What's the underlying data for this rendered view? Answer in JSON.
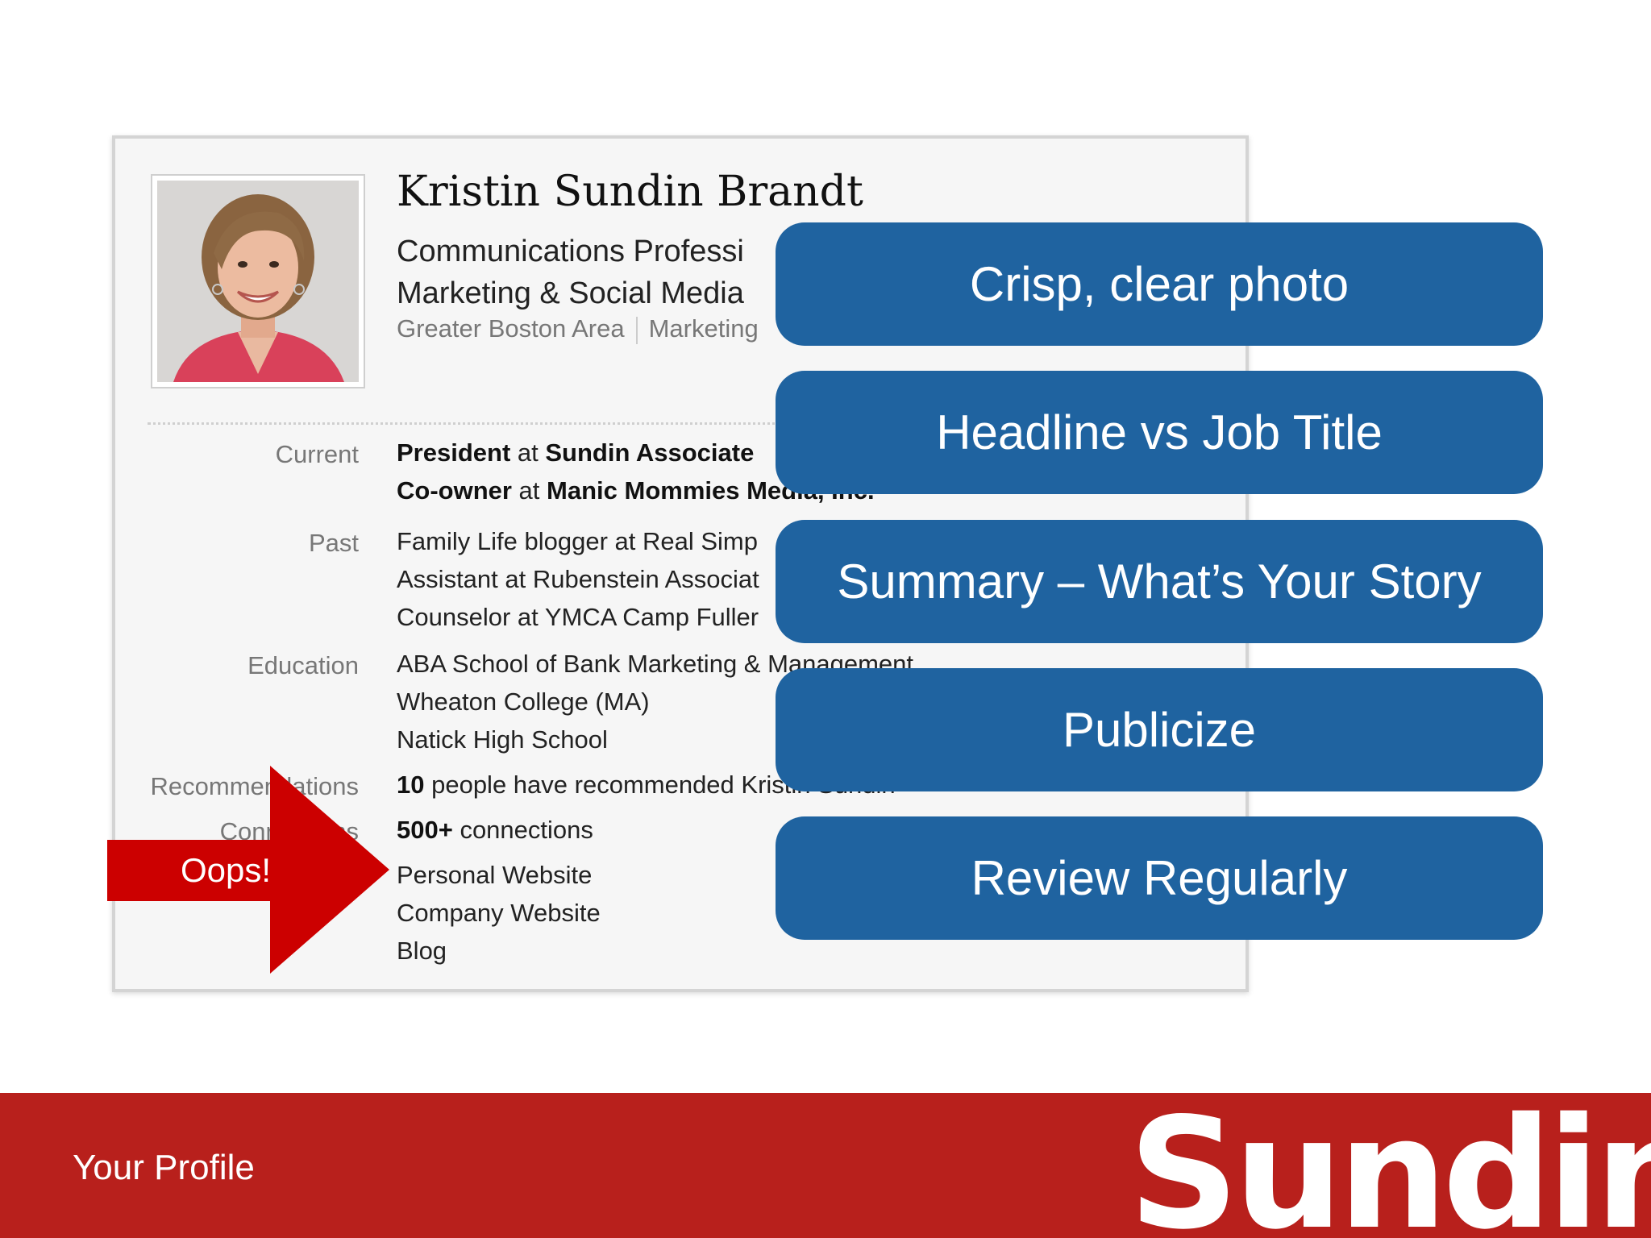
{
  "profile": {
    "name": "Kristin Sundin Brandt",
    "headline_line1": "Communications Professi",
    "headline_line2": "Marketing & Social Media",
    "location": "Greater Boston Area",
    "industry": "Marketing",
    "rows": {
      "current_label": "Current",
      "current_1_role": "President",
      "current_1_at": " at ",
      "current_1_org": "Sundin Associate",
      "current_2_role": "Co-owner",
      "current_2_at": " at ",
      "current_2_org": "Manic Mommies Media, Inc.",
      "past_label": "Past",
      "past_1": "Family Life blogger at Real Simp",
      "past_2": "Assistant at Rubenstein Associat",
      "past_3": "Counselor at YMCA Camp Fuller",
      "education_label": "Education",
      "education_1": "ABA School of Bank Marketing & Management",
      "education_2": "Wheaton College (MA)",
      "education_3": "Natick High School",
      "recommendations_label": "Recommendations",
      "recommendations_count": "10",
      "recommendations_text": " people have recommended Kristin Sundin",
      "connections_label": "Connections",
      "connections_count": "500+",
      "connections_text": " connections",
      "websites_1": "Personal Website",
      "websites_2": "Company Website",
      "websites_3": "Blog"
    }
  },
  "arrow": {
    "label": "Oops!",
    "color": "#cc0000"
  },
  "pills": [
    "Crisp, clear photo",
    "Headline vs Job Title",
    "Summary – What’s Your Story",
    "Publicize",
    "Review Regularly"
  ],
  "footer": {
    "title": "Your Profile",
    "logo": "Sundin",
    "color": "#b8201c"
  },
  "colors": {
    "pill": "#1f63a0"
  }
}
